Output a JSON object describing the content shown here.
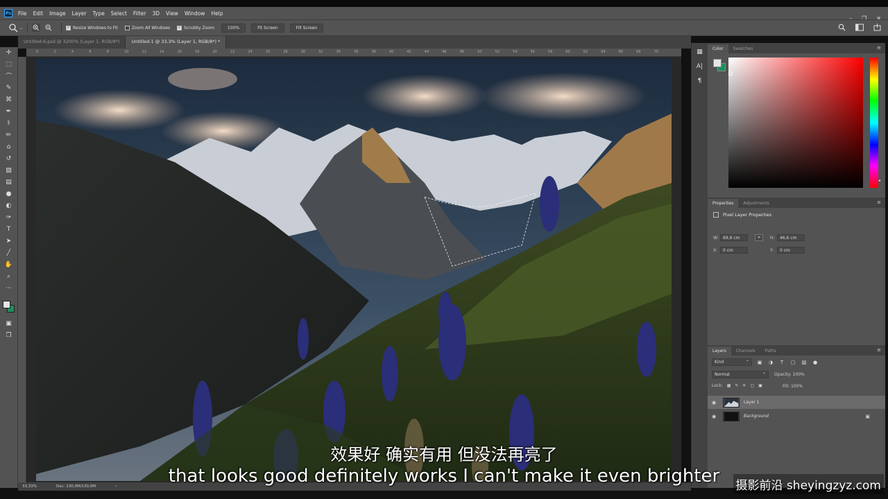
{
  "app": {
    "logo": "Ps"
  },
  "menu": [
    "File",
    "Edit",
    "Image",
    "Layer",
    "Type",
    "Select",
    "Filter",
    "3D",
    "View",
    "Window",
    "Help"
  ],
  "options": {
    "resize_windows": "Resize Windows to Fit",
    "zoom_all": "Zoom All Windows",
    "scrubby": "Scrubby Zoom",
    "zoom_100": "100%",
    "fit_screen": "Fit Screen",
    "fill_screen": "Fill Screen"
  },
  "tabs": [
    {
      "label": "Untitled-6.psd @ 3200% (Layer 1, RGB/8*)"
    },
    {
      "label": "Untitled-1 @ 33,3% (Layer 1, RGB/8*) *"
    }
  ],
  "ruler_ticks": [
    "0",
    "2",
    "4",
    "6",
    "8",
    "10",
    "12",
    "14",
    "16",
    "18",
    "20",
    "22",
    "24",
    "26",
    "28",
    "30",
    "32",
    "34",
    "36",
    "38",
    "40",
    "42",
    "44",
    "46",
    "48",
    "50",
    "52",
    "54",
    "56",
    "58",
    "60",
    "62",
    "64",
    "66",
    "68",
    "70"
  ],
  "status": {
    "zoom": "33,33%",
    "doc": "Doc: 130,0M/130,0M",
    "arrow": "›"
  },
  "color_panel": {
    "tab_color": "Color",
    "tab_swatches": "Swatches"
  },
  "properties": {
    "tab_properties": "Properties",
    "tab_adjustments": "Adjustments",
    "title": "Pixel Layer Properties",
    "w_label": "W:",
    "w_value": "69,9 cm",
    "h_label": "H:",
    "h_value": "46,6 cm",
    "x_label": "X:",
    "x_value": "0 cm",
    "y_label": "Y:",
    "y_value": "0 cm"
  },
  "layers_panel": {
    "tab_layers": "Layers",
    "tab_channels": "Channels",
    "tab_paths": "Paths",
    "kind": "Kind",
    "blend": "Normal",
    "opacity": "Opacity: 100%",
    "lock": "Lock:",
    "fill": "Fill: 100%",
    "layers": [
      {
        "name": "Layer 1"
      },
      {
        "name": "Background"
      }
    ]
  },
  "subtitles": {
    "cn": "效果好 确实有用 但没法再亮了",
    "en": "that looks good definitely works I can't make it even brighter"
  },
  "watermark": "摄影前沿 sheyingzyz.com"
}
